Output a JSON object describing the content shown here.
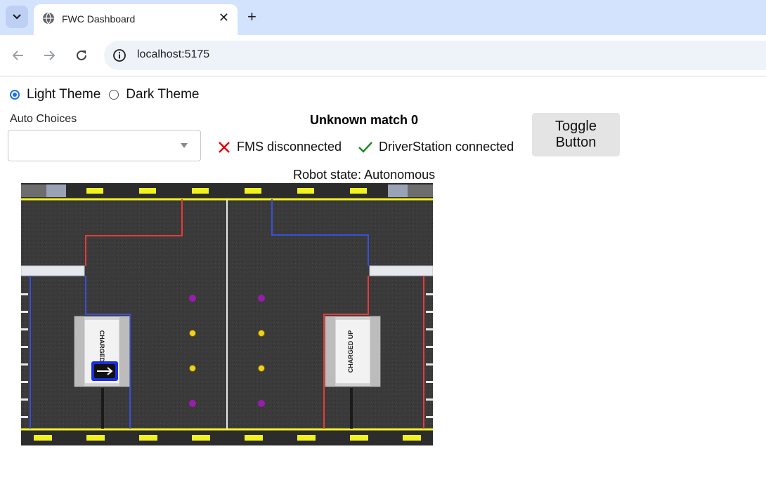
{
  "browser": {
    "tab_title": "FWC Dashboard",
    "url": "localhost:5175"
  },
  "theme": {
    "options": [
      {
        "label": "Light Theme",
        "selected": true
      },
      {
        "label": "Dark Theme",
        "selected": false
      }
    ]
  },
  "auto": {
    "label": "Auto Choices",
    "selected": ""
  },
  "match": {
    "title": "Unknown match 0"
  },
  "connections": {
    "fms": {
      "label": "FMS disconnected",
      "connected": false
    },
    "driverstation": {
      "label": "DriverStation connected",
      "connected": true
    }
  },
  "toggle_button": {
    "label_line1": "Toggle",
    "label_line2": "Button"
  },
  "robot": {
    "state": "Robot state: Autonomous"
  },
  "field": {
    "charge_station_text": "CHARGED UP",
    "colors": {
      "carpet": "#3b3b3b",
      "red": "#e83a3a",
      "blue": "#3a4fd8",
      "yellow": "#f2f21e",
      "cube": "#9b1bb0",
      "cone": "#f2d21e",
      "robot": "#1a2fe0"
    }
  }
}
